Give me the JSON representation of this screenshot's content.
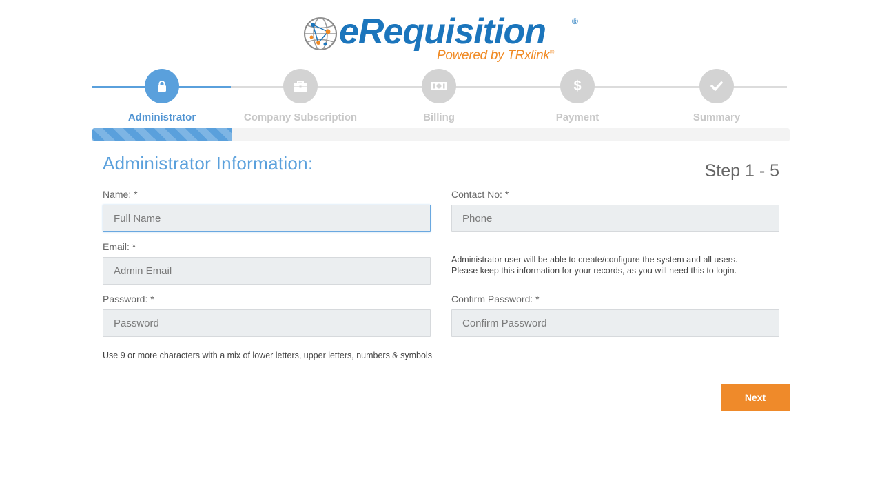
{
  "logo": {
    "wordmark": "eRequisition",
    "registered": "®",
    "powered_by": "Powered by TRxlink",
    "powered_reg": "®"
  },
  "stepper": {
    "steps": [
      {
        "label": "Administrator",
        "icon": "lock-icon",
        "active": true
      },
      {
        "label": "Company Subscription",
        "icon": "briefcase-icon",
        "active": false
      },
      {
        "label": "Billing",
        "icon": "money-icon",
        "active": false
      },
      {
        "label": "Payment",
        "icon": "dollar-icon",
        "active": false
      },
      {
        "label": "Summary",
        "icon": "check-icon",
        "active": false
      }
    ],
    "progress_fraction": 0.2
  },
  "form": {
    "title": "Administrator Information:",
    "step_counter": "Step 1 - 5",
    "name_label": "Name: *",
    "name_placeholder": "Full Name",
    "contact_label": "Contact No: *",
    "contact_placeholder": "Phone",
    "email_label": "Email: *",
    "email_placeholder": "Admin Email",
    "admin_note_line1": "Administrator user will be able to create/configure the system and all users.",
    "admin_note_line2": "Please keep this information for your records, as you will need this to login.",
    "password_label": "Password: *",
    "password_placeholder": "Password",
    "confirm_label": "Confirm Password: *",
    "confirm_placeholder": "Confirm Password",
    "password_hint": "Use 9 or more characters with a mix of lower letters, upper letters, numbers & symbols",
    "next_label": "Next"
  },
  "colors": {
    "primary": "#5aa0dc",
    "accent": "#ef8a2a",
    "inactive": "#d3d3d3"
  }
}
